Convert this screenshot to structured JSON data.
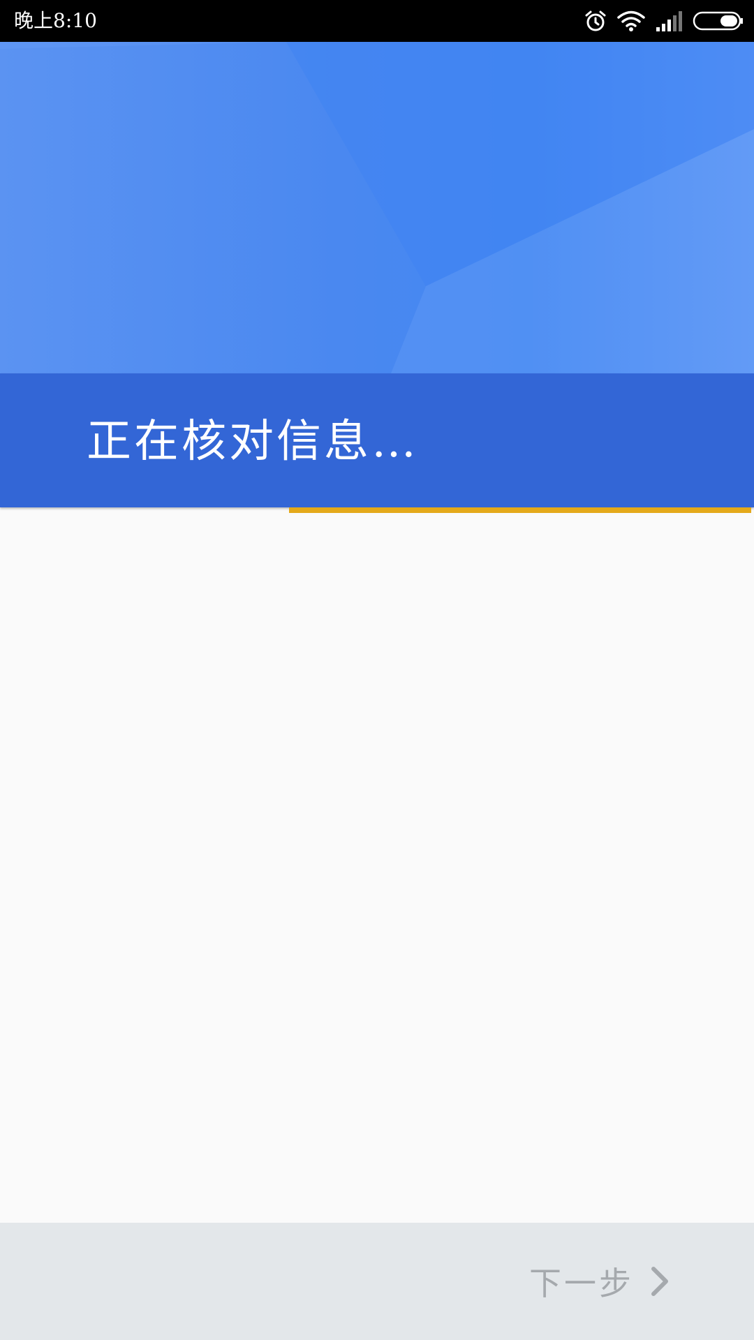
{
  "status_bar": {
    "time": "晚上8:10",
    "icons": [
      "alarm-icon",
      "wifi-icon",
      "signal-icon",
      "battery-icon"
    ]
  },
  "header": {
    "title": "正在核对信息…",
    "colors": {
      "hero": "#4a88f0",
      "band": "#3366d6",
      "progress": "#e4a91a"
    }
  },
  "progress": {
    "value": 0.615
  },
  "footer": {
    "next_label": "下一步",
    "next_icon": "chevron-right-icon",
    "next_enabled": false
  }
}
